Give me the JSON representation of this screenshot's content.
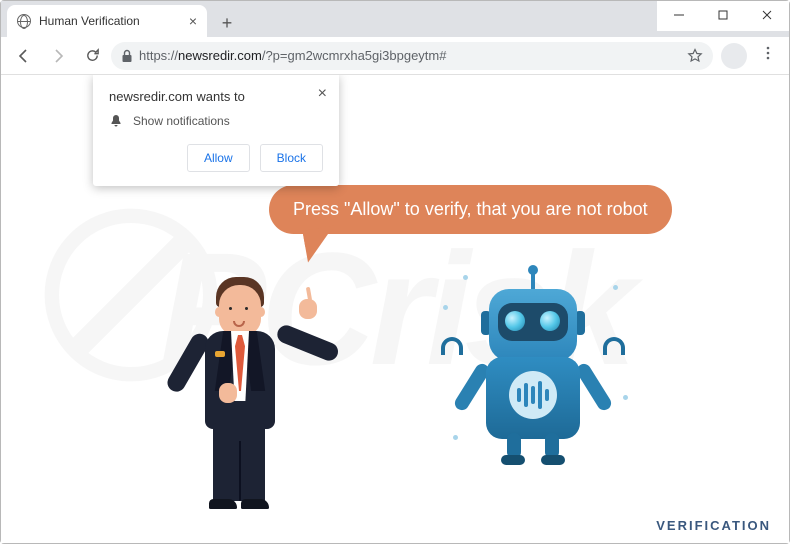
{
  "window": {
    "tab_title": "Human Verification"
  },
  "address_bar": {
    "scheme": "https://",
    "host": "newsredir.com",
    "path": "/?p=gm2wcmrxha5gi3bpgeytm#"
  },
  "notification": {
    "title": "newsredir.com wants to",
    "permission_label": "Show notifications",
    "allow_label": "Allow",
    "block_label": "Block"
  },
  "page": {
    "bubble_text": "Press \"Allow\" to verify, that you are not robot",
    "footer_text": "VERIFICATION"
  },
  "watermark": "PCrisk",
  "colors": {
    "bubble": "#de8459",
    "robot_primary": "#2d86bb"
  }
}
